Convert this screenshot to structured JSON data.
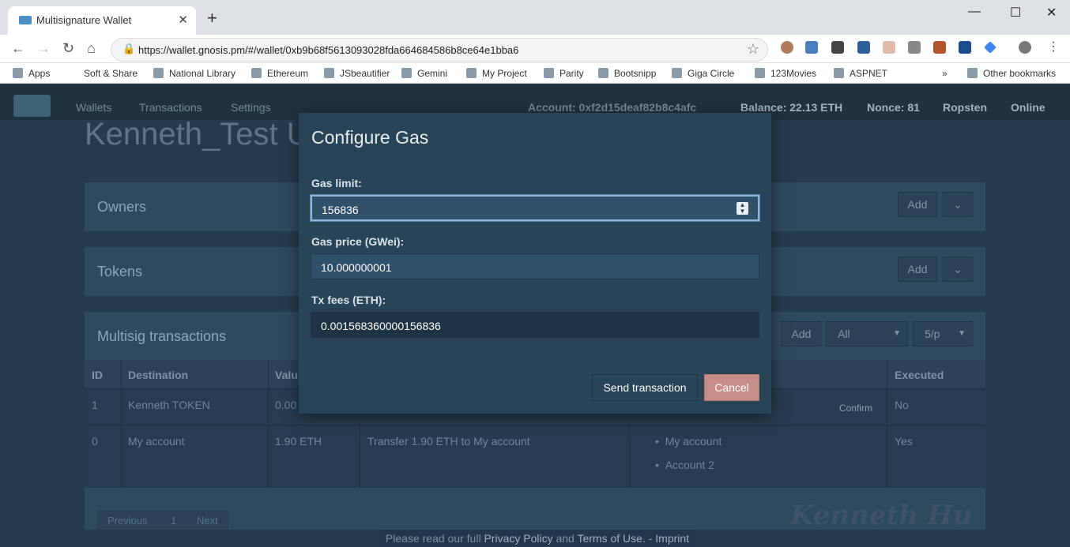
{
  "browser": {
    "tab_title": "Multisignature Wallet",
    "url": "https://wallet.gnosis.pm/#/wallet/0xb9b68f5613093028fda664684586b8ce64e1bba6",
    "bookmarks": [
      "Apps",
      "Soft & Share",
      "National Library",
      "Ethereum",
      "JSbeautifier",
      "Gemini",
      "My Project",
      "Parity",
      "Bootsnipp",
      "Giga Circle",
      "123Movies",
      "ASPNET"
    ],
    "other_bookmarks": "Other bookmarks"
  },
  "appnav": {
    "links": [
      "Wallets",
      "Transactions",
      "Settings"
    ],
    "account": "Account: 0xf2d15deaf82b8c4afc",
    "balance": "Balance: 22.13 ETH",
    "nonce": "Nonce: 81",
    "network": "Ropsten",
    "status": "Online"
  },
  "wallet_title": "Kenneth_Test U",
  "panels": {
    "owners": {
      "title": "Owners",
      "add": "Add"
    },
    "tokens": {
      "title": "Tokens",
      "add": "Add"
    },
    "multisig": {
      "title": "Multisig transactions",
      "add": "Add",
      "filter": "All",
      "per_page": "5/p"
    }
  },
  "table": {
    "headers": [
      "ID",
      "Destination",
      "Valu",
      "Executed"
    ],
    "rows": [
      {
        "id": "1",
        "destination": "Kenneth TOKEN",
        "value": "0.00",
        "action": "Confirm",
        "executed": "No"
      },
      {
        "id": "0",
        "destination": "My account",
        "value": "1.90 ETH",
        "description": "Transfer 1.90 ETH to My account",
        "confirmations": [
          "My account",
          "Account 2"
        ],
        "executed": "Yes"
      }
    ],
    "pagination": {
      "previous": "Previous",
      "page": "1",
      "next": "Next"
    }
  },
  "modal": {
    "title": "Configure Gas",
    "gas_limit_label": "Gas limit:",
    "gas_limit_value": "156836",
    "gas_price_label": "Gas price (GWei):",
    "gas_price_value": "10.000000001",
    "tx_fees_label": "Tx fees (ETH):",
    "tx_fees_value": "0.001568360000156836",
    "send_label": "Send transaction",
    "cancel_label": "Cancel"
  },
  "footer": {
    "pre": "Please read our full ",
    "privacy": "Privacy Policy",
    "and": " and ",
    "terms": "Terms of Use.",
    "imprint": " - Imprint"
  },
  "signature": "Kenneth Hu"
}
